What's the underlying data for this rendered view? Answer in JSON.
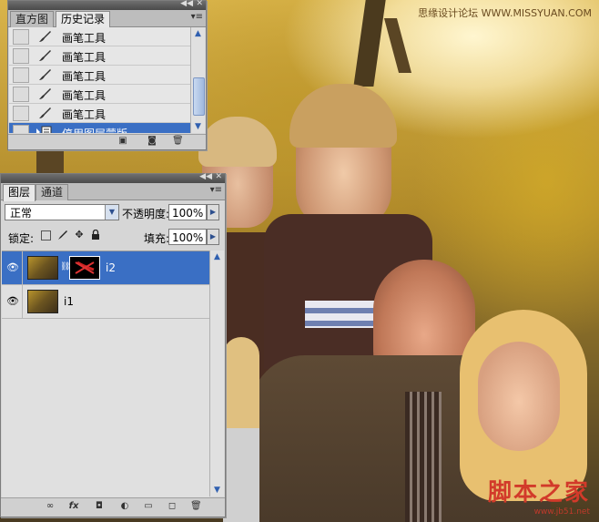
{
  "watermarks": {
    "top": "思缘设计论坛 WWW.MISSYUAN.COM",
    "bottom_big": "脚本之家",
    "bottom_small": "www.jb51.net"
  },
  "history_panel": {
    "tabs": [
      "直方图",
      "历史记录"
    ],
    "active_tab": "历史记录",
    "items": [
      {
        "label": "画笔工具",
        "icon": "brush-icon"
      },
      {
        "label": "画笔工具",
        "icon": "brush-icon"
      },
      {
        "label": "画笔工具",
        "icon": "brush-icon"
      },
      {
        "label": "画笔工具",
        "icon": "brush-icon"
      },
      {
        "label": "画笔工具",
        "icon": "brush-icon"
      },
      {
        "label": "停用图层蒙版",
        "icon": "mask-state-icon",
        "selected": true
      }
    ],
    "bottom_icons": [
      "new-document-from-state-icon",
      "snapshot-icon",
      "trash-icon"
    ]
  },
  "layers_panel": {
    "tabs": [
      "图层",
      "通道"
    ],
    "active_tab": "图层",
    "blend_mode": "正常",
    "opacity_label": "不透明度:",
    "opacity_value": "100%",
    "lock_label": "锁定:",
    "fill_label": "填充:",
    "fill_value": "100%",
    "lock_icons": [
      "lock-transparency-icon",
      "lock-pixels-icon",
      "lock-position-icon",
      "lock-all-icon"
    ],
    "layers": [
      {
        "name": "i2",
        "visible": true,
        "has_mask": true,
        "selected": true
      },
      {
        "name": "i1",
        "visible": true,
        "has_mask": false,
        "selected": false
      }
    ],
    "bottom_icons": [
      "link-icon",
      "fx-icon",
      "mask-icon",
      "adjustment-icon",
      "group-icon",
      "new-layer-icon",
      "trash-icon"
    ]
  },
  "colors": {
    "selection": "#3a6fc4",
    "panel_bg": "#d6d6d6",
    "watermark_red": "#d23a2a"
  }
}
